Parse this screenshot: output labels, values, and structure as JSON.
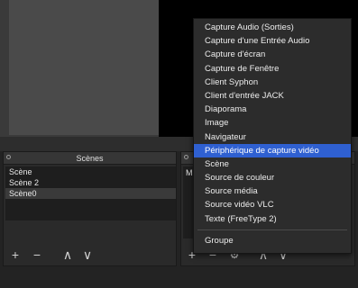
{
  "scenes_panel": {
    "title": "Scènes",
    "items": [
      "Scène",
      "Scène 2",
      "Scène0"
    ],
    "selected_index": 2
  },
  "sources_panel": {
    "visible_text": "M"
  },
  "context_menu": {
    "items": [
      "Capture Audio (Sorties)",
      "Capture d'une Entrée Audio",
      "Capture d'écran",
      "Capture de Fenêtre",
      "Client Syphon",
      "Client d'entrée JACK",
      "Diaporama",
      "Image",
      "Navigateur",
      "Périphérique de capture vidéo",
      "Scène",
      "Source de couleur",
      "Source média",
      "Source vidéo VLC",
      "Texte (FreeType 2)"
    ],
    "highlighted_index": 9,
    "after_separator": "Groupe"
  },
  "toolbar_glyphs": {
    "add": "+",
    "remove": "−",
    "up": "∧",
    "down": "∨",
    "settings": "⚙"
  },
  "colors": {
    "highlight": "#2f60d1"
  }
}
